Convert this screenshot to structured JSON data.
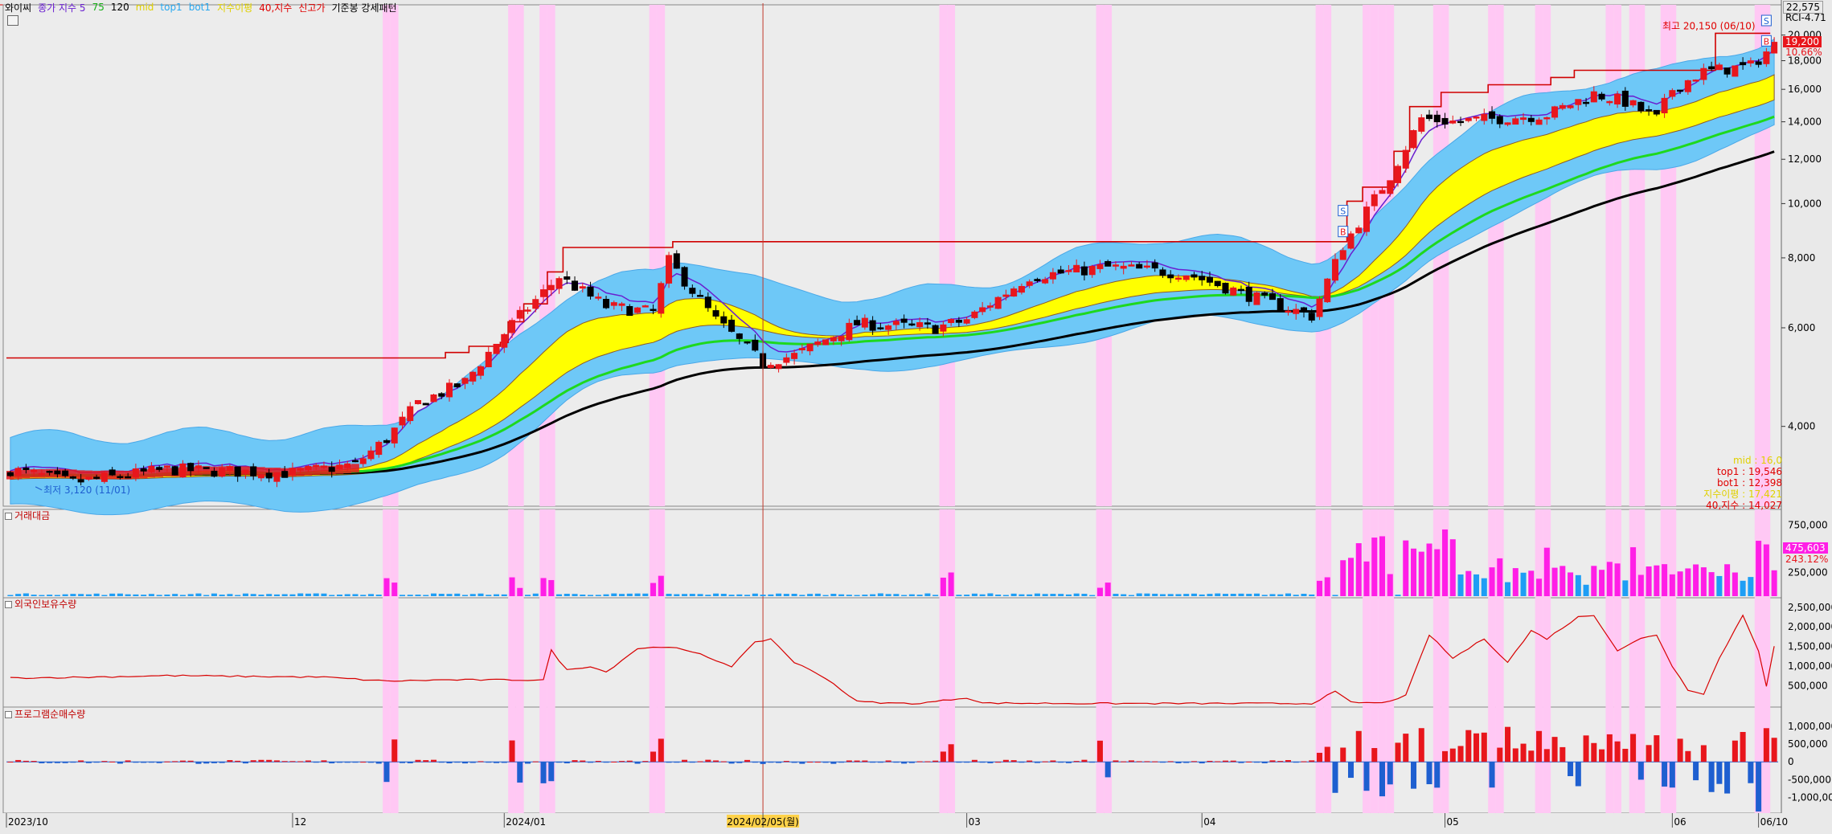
{
  "legend": {
    "items": [
      {
        "label": "와이씨",
        "color": "#000000"
      },
      {
        "label": "종가 지수 5",
        "color": "#6a1fd0"
      },
      {
        "label": "75",
        "color": "#18b018"
      },
      {
        "label": "120",
        "color": "#000000"
      },
      {
        "label": "mid",
        "color": "#e0d000"
      },
      {
        "label": "top1",
        "color": "#28a8f0"
      },
      {
        "label": "bot1",
        "color": "#28a8f0"
      },
      {
        "label": "지수이평",
        "color": "#e0d000"
      },
      {
        "label": "40,지수",
        "color": "#e00000"
      },
      {
        "label": "신고가",
        "color": "#e00000"
      },
      {
        "label": "기준봉 강세패턴",
        "color": "#000000"
      }
    ]
  },
  "panes": {
    "volume_title": "거래대금",
    "foreign_title": "외국인보유수량",
    "program_title": "프로그램순매수량"
  },
  "annotations": {
    "high_label": "최고 20,150 (06/10)",
    "low_label": "최저 3,120 (11/01)",
    "top_right_value": "22,575",
    "top_right_code": "RCI-4.71",
    "current_price": "19,200",
    "change_pct": "10.66%",
    "volume_value": "475,603",
    "volume_pct": "243.12%"
  },
  "info_box": [
    {
      "text": "mid : 16,0",
      "color": "#e0d000"
    },
    {
      "text": "top1 : 19,546",
      "color": "#e00000"
    },
    {
      "text": "bot1 : 12,398",
      "color": "#e00000"
    },
    {
      "text": "지수이평 : 17,421",
      "color": "#e0d000"
    },
    {
      "text": "40,지수 : 14,027",
      "color": "#e00000"
    }
  ],
  "colors": {
    "up": "#e8161c",
    "down": "#000000",
    "band": "#6ec8f7",
    "band_edge": "#4aa8e8",
    "mid_fill": "#ffff00",
    "ma5": "#6a1fd0",
    "ma75": "#1ed81e",
    "ma120": "#000000",
    "newhigh": "#d00000",
    "vol_up": "#ff1ee6",
    "vol_down": "#1e9ef5",
    "prog_up": "#e8161c",
    "prog_down": "#1e5fd0",
    "highlight": "#ffc8f4",
    "foreign_line": "#d80000"
  },
  "chart_data": {
    "type": "candlestick",
    "title": "와이씨",
    "x_ticks": [
      {
        "label": "2023/10",
        "index": 0
      },
      {
        "label": "12",
        "index": 36
      },
      {
        "label": "2024/01",
        "index": 63
      },
      {
        "label": "2024/02/05(월)",
        "index": 96
      },
      {
        "label": "03",
        "index": 122
      },
      {
        "label": "04",
        "index": 152
      },
      {
        "label": "05",
        "index": 183
      },
      {
        "label": "06",
        "index": 212
      },
      {
        "label": "06/10",
        "index": 223
      }
    ],
    "price_axis": {
      "scale": "log",
      "range": [
        2900,
        22500
      ],
      "ticks": [
        4000,
        6000,
        8000,
        10000,
        12000,
        14000,
        16000,
        18000,
        20000
      ]
    },
    "volume_axis": {
      "range": [
        0,
        900000
      ],
      "ticks": [
        250000,
        500000,
        750000
      ]
    },
    "foreign_axis": {
      "range": [
        0,
        2700000
      ],
      "ticks": [
        500000,
        1000000,
        1500000,
        2000000,
        2500000
      ]
    },
    "program_axis": {
      "range": [
        -1400000,
        1500000
      ],
      "ticks": [
        -1000000,
        -500000,
        0,
        500000,
        1000000
      ]
    },
    "highlight_days": [
      48,
      49,
      64,
      65,
      68,
      69,
      82,
      83,
      119,
      120,
      139,
      140,
      167,
      168,
      173,
      174,
      175,
      176,
      182,
      183,
      189,
      190,
      195,
      196,
      204,
      205,
      207,
      208,
      211,
      212,
      223,
      224
    ],
    "new_high_steps": [
      {
        "from": 0,
        "to": 55,
        "value": 5300
      },
      {
        "from": 56,
        "to": 58,
        "value": 5420
      },
      {
        "from": 59,
        "to": 62,
        "value": 5560
      },
      {
        "from": 63,
        "to": 63,
        "value": 5650
      },
      {
        "from": 64,
        "to": 65,
        "value": 6150
      },
      {
        "from": 66,
        "to": 68,
        "value": 6620
      },
      {
        "from": 69,
        "to": 70,
        "value": 7550
      },
      {
        "from": 71,
        "to": 84,
        "value": 8350
      },
      {
        "from": 85,
        "to": 170,
        "value": 8550
      },
      {
        "from": 171,
        "to": 172,
        "value": 10100
      },
      {
        "from": 173,
        "to": 176,
        "value": 10700
      },
      {
        "from": 177,
        "to": 178,
        "value": 12400
      },
      {
        "from": 179,
        "to": 182,
        "value": 14900
      },
      {
        "from": 183,
        "to": 188,
        "value": 15800
      },
      {
        "from": 189,
        "to": 196,
        "value": 16300
      },
      {
        "from": 197,
        "to": 199,
        "value": 16800
      },
      {
        "from": 200,
        "to": 217,
        "value": 17300
      },
      {
        "from": 218,
        "to": 224,
        "value": 20150
      }
    ],
    "signals": [
      {
        "index": 170,
        "text": "S",
        "value": 9700
      },
      {
        "index": 170,
        "text": "B",
        "value": 8900
      },
      {
        "index": 224,
        "text": "S",
        "value": 21200
      },
      {
        "index": 224,
        "text": "B",
        "value": 19500
      }
    ],
    "high": {
      "index": 223,
      "value": 20150,
      "date": "06/10"
    },
    "low": {
      "index": 3,
      "value": 3120,
      "date": "11/01"
    }
  }
}
